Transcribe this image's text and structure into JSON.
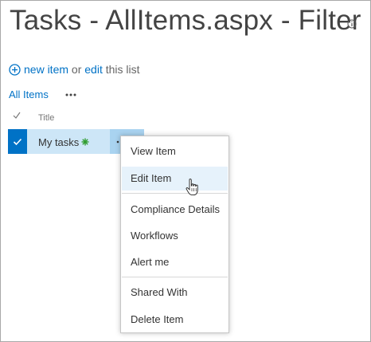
{
  "page": {
    "title": "Tasks - AllItems.aspx - Filter"
  },
  "commands": {
    "new_item": "new item",
    "or": "or",
    "edit": "edit",
    "this_list": "this list"
  },
  "views": {
    "current": "All Items"
  },
  "list": {
    "column_title": "Title",
    "rows": [
      {
        "title": "My tasks",
        "is_new": true,
        "selected": true
      }
    ]
  },
  "context_menu": {
    "items": [
      {
        "label": "View Item"
      },
      {
        "label": "Edit Item",
        "hovered": true
      },
      {
        "label": "Compliance Details"
      },
      {
        "label": "Workflows"
      },
      {
        "label": "Alert me"
      },
      {
        "label": "Shared With"
      },
      {
        "label": "Delete Item"
      }
    ]
  },
  "colors": {
    "accent": "#0072c6",
    "row_selected": "#cde6f7",
    "new_badge": "#2e9c2e"
  }
}
